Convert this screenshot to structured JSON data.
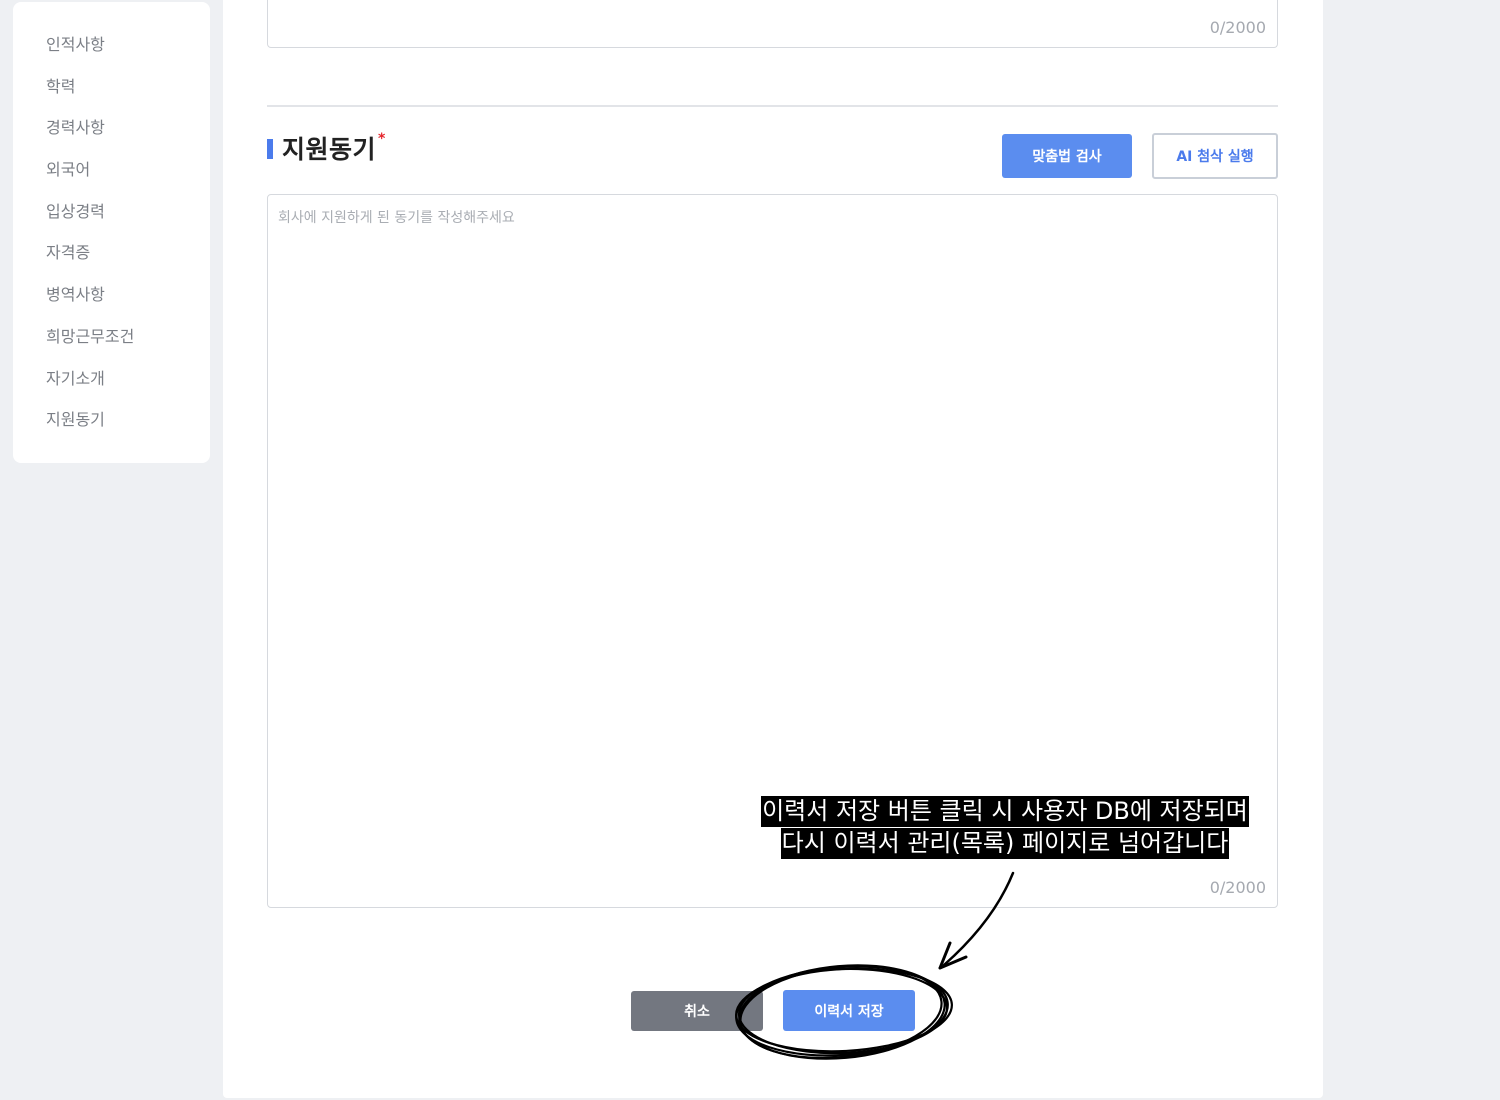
{
  "sidebar": {
    "items": [
      {
        "label": "인적사항"
      },
      {
        "label": "학력"
      },
      {
        "label": "경력사항"
      },
      {
        "label": "외국어"
      },
      {
        "label": "입상경력"
      },
      {
        "label": "자격증"
      },
      {
        "label": "병역사항"
      },
      {
        "label": "희망근무조건"
      },
      {
        "label": "자기소개"
      },
      {
        "label": "지원동기"
      }
    ]
  },
  "previous_field": {
    "counter": "0/2000"
  },
  "motivation": {
    "title": "지원동기",
    "required_mark": "*",
    "spell_check_label": "맞춤법 검사",
    "ai_review_label": "AI 첨삭 실행",
    "placeholder": "회사에 지원하게 된 동기를 작성해주세요",
    "value": "",
    "counter": "0/2000"
  },
  "footer": {
    "cancel_label": "취소",
    "save_label": "이력서 저장"
  },
  "annotation": {
    "line1": "이력서 저장 버튼 클릭 시 사용자 DB에 저장되며",
    "line2": "다시 이력서 관리(목록) 페이지로 넘어갑니다"
  },
  "colors": {
    "accent": "#5b8def",
    "required": "#e5242b",
    "cancel": "#737780",
    "background": "#eef0f3"
  }
}
